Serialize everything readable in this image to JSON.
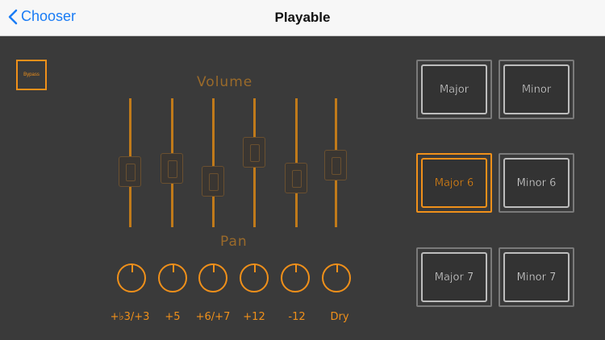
{
  "nav": {
    "back_label": "Chooser",
    "title": "Playable"
  },
  "bypass": {
    "label": "Bypass"
  },
  "volume": {
    "label": "Volume"
  },
  "pan": {
    "label": "Pan"
  },
  "channels": [
    "+♭3/+3",
    "+5",
    "+6/+7",
    "+12",
    "-12",
    "Dry"
  ],
  "pads": [
    {
      "label": "Major",
      "active": false
    },
    {
      "label": "Minor",
      "active": false
    },
    {
      "label": "Major 6",
      "active": true
    },
    {
      "label": "Minor 6",
      "active": false
    },
    {
      "label": "Major 7",
      "active": false
    },
    {
      "label": "Minor 7",
      "active": false
    }
  ],
  "colors": {
    "accent": "#f0901a",
    "nav_link": "#1a7cf5",
    "background": "#3a3a3a"
  }
}
